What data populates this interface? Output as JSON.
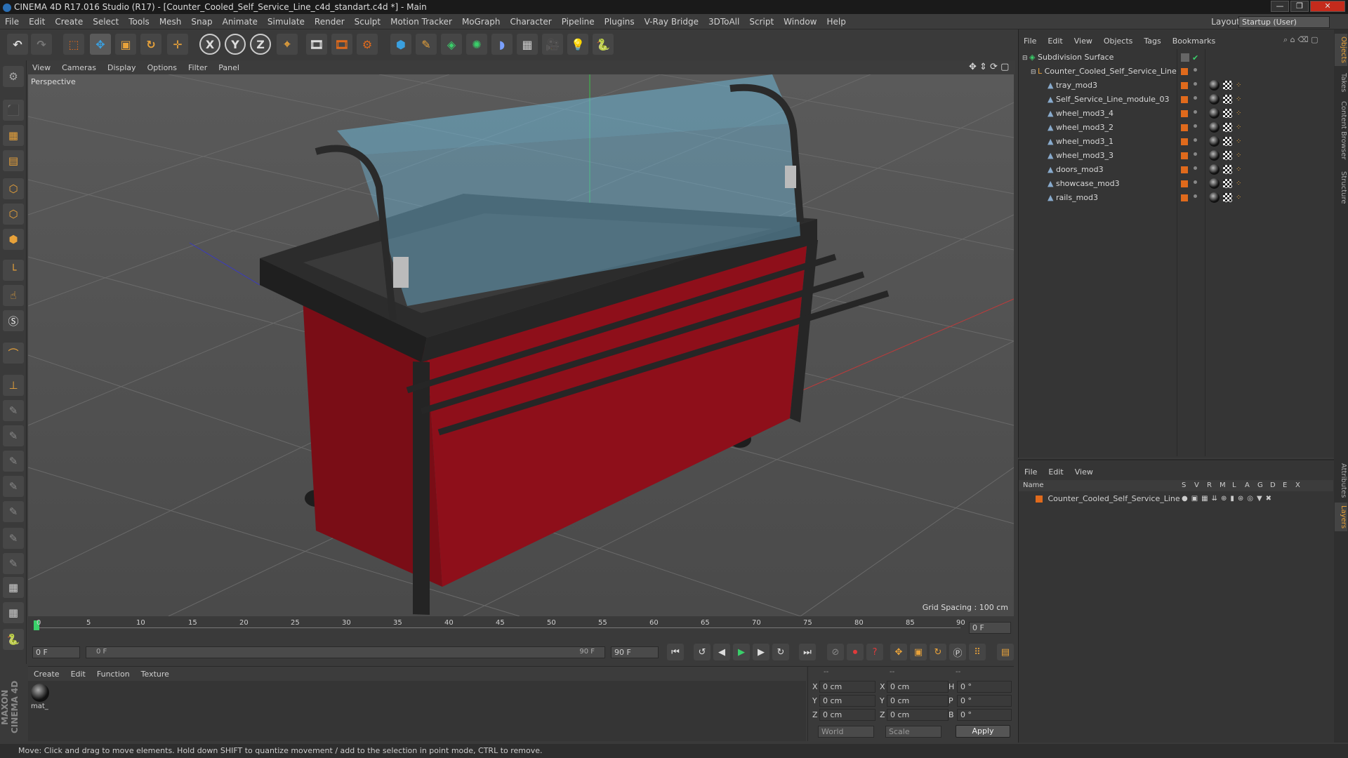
{
  "window": {
    "title": "CINEMA 4D R17.016 Studio (R17) - [Counter_Cooled_Self_Service_Line_c4d_standart.c4d *] - Main",
    "minimize": "—",
    "maximize": "❐",
    "close": "✕"
  },
  "menubar": {
    "items": [
      "File",
      "Edit",
      "Create",
      "Select",
      "Tools",
      "Mesh",
      "Snap",
      "Animate",
      "Simulate",
      "Render",
      "Sculpt",
      "Motion Tracker",
      "MoGraph",
      "Character",
      "Pipeline",
      "Plugins",
      "V-Ray Bridge",
      "3DToAll",
      "Script",
      "Window",
      "Help"
    ],
    "layout_label": "Layout:",
    "layout_value": "Startup (User)"
  },
  "toolbar": {
    "axis_x": "X",
    "axis_y": "Y",
    "axis_z": "Z"
  },
  "viewport": {
    "menu": [
      "View",
      "Cameras",
      "Display",
      "Options",
      "Filter",
      "Panel"
    ],
    "label": "Perspective",
    "grid_spacing": "Grid Spacing : 100 cm"
  },
  "timeline": {
    "ticks": [
      "0",
      "5",
      "10",
      "15",
      "20",
      "25",
      "30",
      "35",
      "40",
      "45",
      "50",
      "55",
      "60",
      "65",
      "70",
      "75",
      "80",
      "85",
      "90"
    ],
    "current_frame_right": "0 F",
    "start_field": "0 F",
    "range_start": "0 F",
    "range_end": "90 F",
    "end_field": "90 F"
  },
  "material_panel": {
    "menu": [
      "Create",
      "Edit",
      "Function",
      "Texture"
    ],
    "material_name": "mat_"
  },
  "coordinates": {
    "header": [
      "--",
      "--",
      "--"
    ],
    "rows": [
      {
        "a": "X",
        "av": "0 cm",
        "b": "X",
        "bv": "0 cm",
        "c": "H",
        "cv": "0 °"
      },
      {
        "a": "Y",
        "av": "0 cm",
        "b": "Y",
        "bv": "0 cm",
        "c": "P",
        "cv": "0 °"
      },
      {
        "a": "Z",
        "av": "0 cm",
        "b": "Z",
        "bv": "0 cm",
        "c": "B",
        "cv": "0 °"
      }
    ],
    "world": "World",
    "scale": "Scale",
    "apply": "Apply"
  },
  "object_manager": {
    "menu": [
      "File",
      "Edit",
      "View",
      "Objects",
      "Tags",
      "Bookmarks"
    ],
    "objects": [
      {
        "name": "Subdivision Surface",
        "level": 0
      },
      {
        "name": "Counter_Cooled_Self_Service_Line",
        "level": 1
      },
      {
        "name": "tray_mod3",
        "level": 2
      },
      {
        "name": "Self_Service_Line_module_03",
        "level": 2
      },
      {
        "name": "wheel_mod3_4",
        "level": 2
      },
      {
        "name": "wheel_mod3_2",
        "level": 2
      },
      {
        "name": "wheel_mod3_1",
        "level": 2
      },
      {
        "name": "wheel_mod3_3",
        "level": 2
      },
      {
        "name": "doors_mod3",
        "level": 2
      },
      {
        "name": "showcase_mod3",
        "level": 2
      },
      {
        "name": "rails_mod3",
        "level": 2
      }
    ]
  },
  "layer_manager": {
    "menu": [
      "File",
      "Edit",
      "View"
    ],
    "name_header": "Name",
    "col_headers": [
      "S",
      "V",
      "R",
      "M",
      "L",
      "A",
      "G",
      "D",
      "E",
      "X"
    ],
    "layers": [
      "Counter_Cooled_Self_Service_Line"
    ]
  },
  "right_tabs": [
    "Objects",
    "Takes",
    "Content Browser",
    "Structure",
    "Attributes",
    "Layers"
  ],
  "branding": "MAXON CINEMA 4D",
  "status": "Move: Click and drag to move elements. Hold down SHIFT to quantize movement / add to the selection in point mode, CTRL to remove.",
  "colors": {
    "accent_orange": "#e06a1c",
    "cabinet_red": "#8e0f1a",
    "glass_blue": "#6fb6d6"
  }
}
